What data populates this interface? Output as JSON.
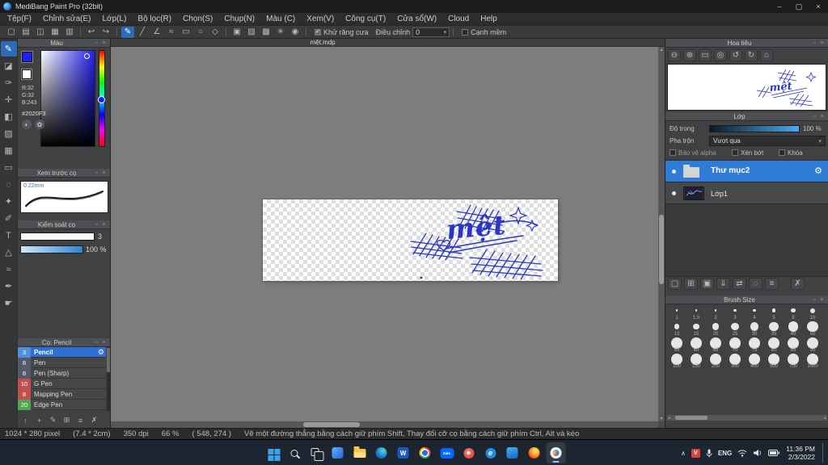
{
  "ui": {
    "popout_glyph": "▫",
    "close_glyph": "×"
  },
  "window": {
    "title": "MediBang Paint Pro (32bit)",
    "minimize_glyph": "–",
    "maximize_glyph": "▢",
    "close_glyph": "×"
  },
  "menu": {
    "items": [
      "Tệp(F)",
      "Chỉnh sửa(E)",
      "Lớp(L)",
      "Bộ lọc(R)",
      "Chọn(S)",
      "Chụp(N)",
      "Màu (C)",
      "Xem(V)",
      "Công cụ(T)",
      "Cửa sổ(W)",
      "Cloud",
      "Help"
    ]
  },
  "toolbar": {
    "icons": [
      {
        "name": "new-canvas-icon",
        "glyph": "▢"
      },
      {
        "name": "open-file-icon",
        "glyph": "▤"
      },
      {
        "name": "save-icon",
        "glyph": "◫"
      },
      {
        "name": "grid-view-icon",
        "glyph": "▦"
      },
      {
        "name": "material-icon",
        "glyph": "▥"
      },
      {
        "sep": true
      },
      {
        "name": "undo-icon",
        "glyph": "↩"
      },
      {
        "name": "redo-icon",
        "glyph": "↪"
      },
      {
        "sep": true
      },
      {
        "name": "freehand-icon",
        "glyph": "✎",
        "selected": true
      },
      {
        "name": "line-icon",
        "glyph": "╱"
      },
      {
        "name": "polyline-icon",
        "glyph": "∠"
      },
      {
        "name": "curve-icon",
        "glyph": "≈"
      },
      {
        "name": "rect-icon",
        "glyph": "▭"
      },
      {
        "name": "ellipse-icon",
        "glyph": "○"
      },
      {
        "name": "polygon-icon",
        "glyph": "◇"
      },
      {
        "sep": true
      },
      {
        "name": "snap-off-icon",
        "glyph": "▣"
      },
      {
        "name": "snap-parallel-icon",
        "glyph": "▨"
      },
      {
        "name": "snap-cross-icon",
        "glyph": "▩"
      },
      {
        "name": "snap-vanish-icon",
        "glyph": "✳"
      },
      {
        "name": "snap-circle-icon",
        "glyph": "◉"
      },
      {
        "sep": true
      }
    ],
    "antialias_label": "Khử răng cưa",
    "correction_label": "Điều chỉnh",
    "correction_value": "0",
    "soft_edge_label": "Cạnh mềm",
    "check_glyph": "✓",
    "caret_glyph": "▾"
  },
  "tool_strip": {
    "tools": [
      {
        "name": "brush-tool",
        "glyph": "✎",
        "selected": true
      },
      {
        "name": "eraser-tool",
        "glyph": "◪"
      },
      {
        "name": "pen-tool",
        "glyph": "✑"
      },
      {
        "name": "move-tool",
        "glyph": "✛"
      },
      {
        "name": "fill-tool",
        "glyph": "◧"
      },
      {
        "name": "gradient-tool",
        "glyph": "▨"
      },
      {
        "name": "tile-tool",
        "glyph": "▦"
      },
      {
        "name": "select-tool",
        "glyph": "▭"
      },
      {
        "name": "lasso-tool",
        "glyph": "◌"
      },
      {
        "name": "magic-wand-tool",
        "glyph": "✦"
      },
      {
        "name": "select-pen-tool",
        "glyph": "✐"
      },
      {
        "name": "text-tool",
        "glyph": "T"
      },
      {
        "name": "shape-tool",
        "glyph": "△"
      },
      {
        "name": "curve-tool",
        "glyph": "≈"
      },
      {
        "name": "eyedropper-tool",
        "glyph": "✒"
      },
      {
        "name": "hand-tool",
        "glyph": "☛"
      }
    ]
  },
  "color_panel": {
    "title": "Màu",
    "r_label": "R:32",
    "g_label": "G:32",
    "b_label": "B:243",
    "hex": "#2020F3",
    "primary_color": "#2020f3",
    "wheel_glyph": "◐",
    "palette_glyph": "✿"
  },
  "brush_preview": {
    "title": "Xem trước cọ",
    "size_label": "0.22mm"
  },
  "brush_control": {
    "title": "Kiểm soát cọ",
    "size_value": "3",
    "opacity_value": "100 %"
  },
  "brush_panel": {
    "title": "Cọ: Pencil",
    "gear_glyph": "⚙",
    "brushes": [
      {
        "size": "3",
        "name": "Pencil",
        "chip": "#4f8fdd",
        "selected": true
      },
      {
        "size": "8",
        "name": "Pen",
        "chip": "#55596a",
        "selected": false
      },
      {
        "size": "8",
        "name": "Pen (Sharp)",
        "chip": "#55596a",
        "selected": false
      },
      {
        "size": "10",
        "name": "G Pen",
        "chip": "#c0504d",
        "selected": false
      },
      {
        "size": "8",
        "name": "Mapping Pen",
        "chip": "#c0504d",
        "selected": false
      },
      {
        "size": "20",
        "name": "Edge Pen",
        "chip": "#4ea64e",
        "selected": false
      }
    ],
    "bottom_icons": [
      {
        "name": "brush-up-icon",
        "glyph": "↑"
      },
      {
        "name": "add-brush-icon",
        "glyph": "+"
      },
      {
        "name": "edit-brush-icon",
        "glyph": "✎"
      },
      {
        "name": "brush-folder-icon",
        "glyph": "⊞"
      },
      {
        "name": "brush-menu-icon",
        "glyph": "≡"
      },
      {
        "name": "delete-brush-icon",
        "glyph": "✗"
      }
    ]
  },
  "canvas": {
    "tab": "mệt.mdp",
    "art_text": "mệt"
  },
  "navigator": {
    "title": "Hoa tiêu",
    "buttons": [
      {
        "name": "zoom-out-icon",
        "glyph": "⊖"
      },
      {
        "name": "zoom-in-icon",
        "glyph": "⊕"
      },
      {
        "name": "fit-screen-icon",
        "glyph": "▭"
      },
      {
        "name": "actual-pixels-icon",
        "glyph": "◎"
      },
      {
        "name": "rotate-left-icon",
        "glyph": "↺"
      },
      {
        "name": "rotate-right-icon",
        "glyph": "↻"
      },
      {
        "name": "reset-view-icon",
        "glyph": "⌂"
      }
    ]
  },
  "layers": {
    "title": "Lớp",
    "opacity_label": "Độ trong",
    "opacity_value": "100 %",
    "blend_label": "Pha trộn",
    "blend_value": "Vượt qua",
    "protect_alpha_label": "Bảo vệ alpha",
    "clipping_label": "Xén bớt",
    "lock_label": "Khóa",
    "gear_glyph": "⚙",
    "caret_glyph": "▾",
    "items": [
      {
        "name": "Thư mục2",
        "type": "folder",
        "selected": true
      },
      {
        "name": "Lớp1",
        "type": "layer",
        "selected": false
      }
    ],
    "tool_buttons": [
      {
        "name": "add-layer-icon",
        "glyph": "▢"
      },
      {
        "name": "add-folder-icon",
        "glyph": "⊞"
      },
      {
        "name": "duplicate-layer-icon",
        "glyph": "▣"
      },
      {
        "name": "merge-down-icon",
        "glyph": "⇓"
      },
      {
        "name": "transfer-icon",
        "glyph": "⇄"
      },
      {
        "name": "clear-layer-icon",
        "glyph": "◌"
      },
      {
        "name": "layer-menu-icon",
        "glyph": "≡"
      },
      {
        "name": "delete-layer-icon",
        "glyph": "✗",
        "trash": true
      }
    ]
  },
  "brush_size": {
    "title": "Brush Size",
    "sizes": [
      1,
      1.5,
      2,
      3,
      4,
      5,
      8,
      10,
      13,
      15,
      20,
      25,
      30,
      35,
      40,
      50,
      55,
      60,
      65,
      70,
      75,
      80,
      85,
      90,
      100,
      150,
      200,
      300,
      400,
      500,
      700,
      1000
    ]
  },
  "status": {
    "size": "1024 * 280 pixel",
    "physical": "(7.4 * 2cm)",
    "dpi": "350 dpi",
    "zoom": "66 %",
    "coords": "( 548, 274 )",
    "hint": "Vẽ một đường thẳng bằng cách giữ phím Shift, Thay đổi cỡ cọ bằng cách giữ phím Ctrl, Alt và kéo"
  },
  "taskbar": {
    "apps": [
      {
        "name": "start"
      },
      {
        "name": "search"
      },
      {
        "name": "task-view"
      },
      {
        "name": "widgets"
      },
      {
        "name": "file-explorer"
      },
      {
        "name": "edge"
      },
      {
        "name": "word",
        "label": "W"
      },
      {
        "name": "chrome"
      },
      {
        "name": "zalo",
        "label": "Zalo"
      },
      {
        "name": "red-app"
      },
      {
        "name": "edge-blue",
        "label": "e"
      },
      {
        "name": "blue-app"
      },
      {
        "name": "firefox"
      },
      {
        "name": "medibang",
        "active": true
      }
    ],
    "tray": {
      "hidden_glyph": "∧",
      "badge_label": "V",
      "lang": "ENG",
      "time": "11:36 PM",
      "date": "2/3/2022"
    }
  }
}
